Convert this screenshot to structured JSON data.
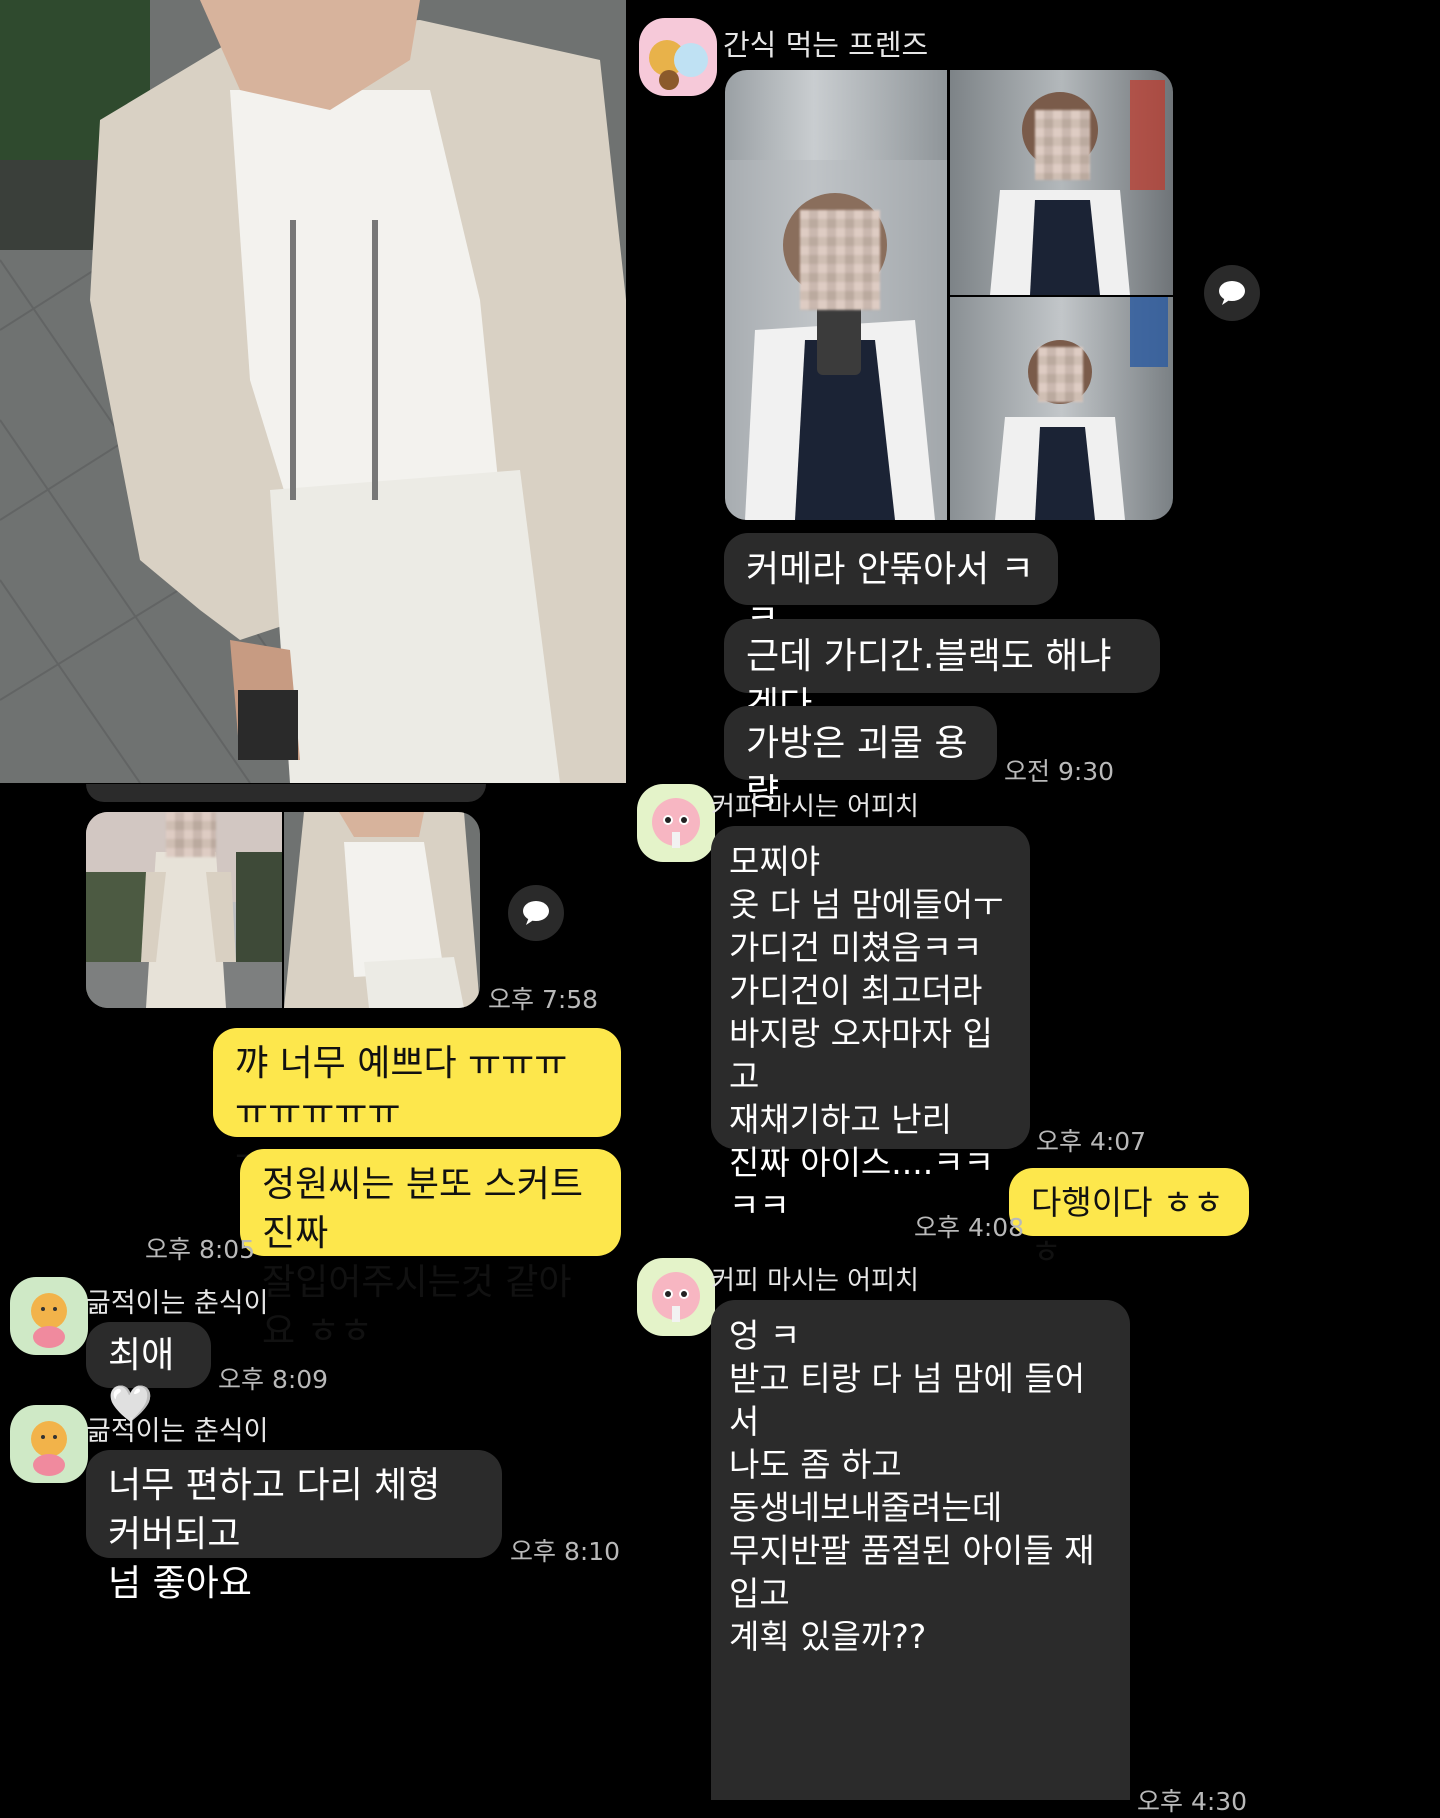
{
  "top_right_chat": {
    "room_name": "간식 먹는 프렌즈",
    "messages": [
      {
        "text": "커메라 안뚞아서 ㅋㅋ"
      },
      {
        "text": "근데 가디간.블랙도 해냐겟다"
      },
      {
        "text": "가방은 괴물 용량"
      }
    ],
    "time": "오전 9:30"
  },
  "bottom_left_chat": {
    "photo_time": "오후 7:58",
    "my_messages": [
      {
        "text": "꺄 너무 예쁘다 ㅠㅠㅠㅠㅠㅠㅠㅠ\nㅠ"
      },
      {
        "text": "정원씨는 분또 스커트 진짜\n잘입어주시는것 같아요 ㅎㅎ"
      }
    ],
    "my_time": "오후 8:05",
    "sender_name": "긂적이는 춘식이",
    "reply1": {
      "text": "최애🤍",
      "time": "오후 8:09"
    },
    "sender_name2": "긂적이는 춘식이",
    "reply2": {
      "text": "너무 편하고 다리 체형 커버되고\n넘 좋아요",
      "time": "오후 8:10"
    }
  },
  "bottom_right_chat": {
    "sender_name": "커피 마시는 어피치",
    "message1": {
      "text": "모찌야\n옷 다 넘 맘에들어ㅜ\n가디건 미쳤음ㅋㅋ\n가디건이 최고더라\n바지랑 오자마자 입고\n재채기하고 난리\n진짜 아이스....ㅋㅋㅋㅋ",
      "time": "오후 4:07"
    },
    "my_reply": {
      "text": "다행이다 ㅎㅎㅎ",
      "time": "오후 4:08"
    },
    "sender_name2": "커피 마시는 어피치",
    "message2": {
      "text": "엉 ㅋ\n받고 티랑 다 넘 맘에 들어서\n나도 좀 하고\n동생네보내줄려는데\n무지반팔 품절된 아이들 재입고\n계획 있을까??",
      "time": "오후 4:30"
    }
  },
  "icons": {
    "share": "speech-bubble-icon",
    "avatar_group": "friends-avatar-icon",
    "avatar_peach": "apeach-avatar-icon",
    "avatar_choonsik": "choonsik-avatar-icon"
  },
  "colors": {
    "background": "#000000",
    "bubble_other": "#2b2b2b",
    "bubble_me": "#fde74c",
    "timestamp": "#b9b9b9"
  }
}
